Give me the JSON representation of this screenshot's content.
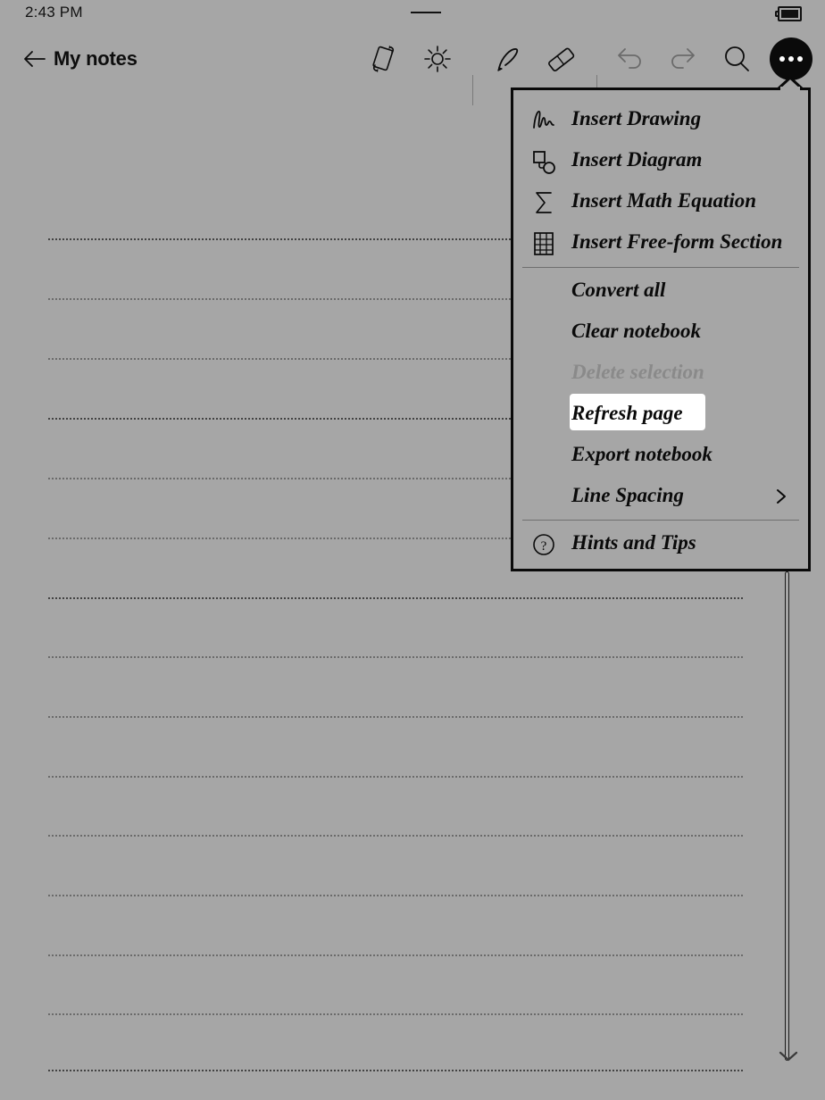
{
  "status_bar": {
    "time": "2:43 PM",
    "battery_icon": "battery-full-icon",
    "center_indicator": "home-indicator-dash"
  },
  "toolbar": {
    "back_label": "back-arrow",
    "title": "My notes",
    "buttons": [
      {
        "name": "rotate-screen-button",
        "icon": "rotate-screen-icon",
        "enabled": true
      },
      {
        "name": "brightness-button",
        "icon": "brightness-sun-icon",
        "enabled": true
      },
      {
        "name": "pen-tool-button",
        "icon": "pen-icon",
        "enabled": true
      },
      {
        "name": "eraser-tool-button",
        "icon": "eraser-icon",
        "enabled": true
      },
      {
        "name": "undo-button",
        "icon": "undo-arrow-icon",
        "enabled": false
      },
      {
        "name": "redo-button",
        "icon": "redo-arrow-icon",
        "enabled": false
      },
      {
        "name": "search-button",
        "icon": "search-icon",
        "enabled": true
      }
    ],
    "more_button": {
      "name": "more-options-button",
      "icon": "ellipsis-icon",
      "expanded": true
    }
  },
  "more_menu": {
    "visible": true,
    "groups": [
      {
        "name": "insert-group",
        "items": [
          {
            "label": "Insert Drawing",
            "icon": "scribble-icon",
            "state": "enabled",
            "submenu": false
          },
          {
            "label": "Insert Diagram",
            "icon": "shapes-icon",
            "state": "enabled",
            "submenu": false
          },
          {
            "label": "Insert Math Equation",
            "icon": "sigma-icon",
            "state": "enabled",
            "submenu": false
          },
          {
            "label": "Insert Free-form Section",
            "icon": "grid-table-icon",
            "state": "enabled",
            "submenu": false
          }
        ]
      },
      {
        "name": "actions-group",
        "items": [
          {
            "label": "Convert all",
            "icon": "",
            "state": "enabled",
            "submenu": false
          },
          {
            "label": "Clear notebook",
            "icon": "",
            "state": "enabled",
            "submenu": false
          },
          {
            "label": "Delete selection",
            "icon": "",
            "state": "disabled",
            "submenu": false
          },
          {
            "label": "Refresh page",
            "icon": "",
            "state": "highlighted",
            "submenu": false
          },
          {
            "label": "Export notebook",
            "icon": "",
            "state": "enabled",
            "submenu": false
          },
          {
            "label": "Line Spacing",
            "icon": "",
            "state": "enabled",
            "submenu": true
          }
        ]
      },
      {
        "name": "help-group",
        "items": [
          {
            "label": "Hints and Tips",
            "icon": "question-circle-icon",
            "state": "enabled",
            "submenu": false
          }
        ]
      }
    ]
  },
  "page": {
    "rule_style": "dotted",
    "line_count": 15,
    "scrollbar": {
      "name": "vertical-scrollbar",
      "position": "bottom"
    },
    "scroll_down_icon": "chevron-down-icon"
  },
  "colors": {
    "background": "#a6a6a6",
    "ink": "#0a0a0a",
    "disabled": "#8a8a8a",
    "highlight": "#ffffff",
    "separator": "#6f6f6f"
  }
}
